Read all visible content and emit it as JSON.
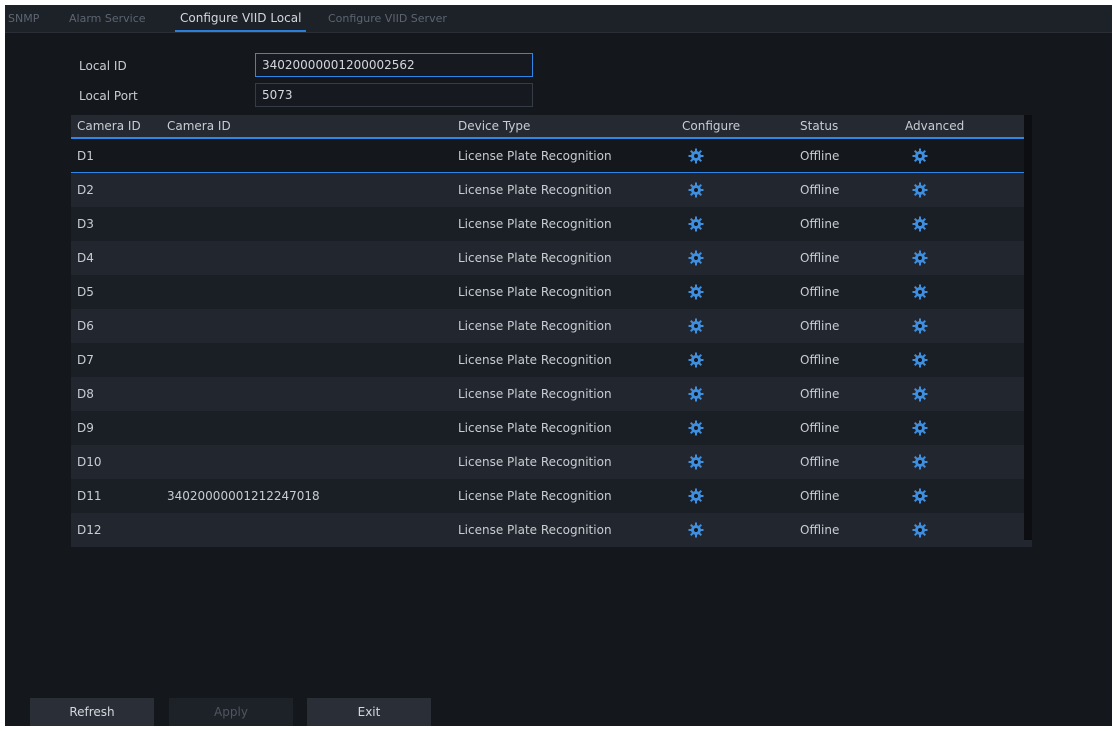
{
  "tabs": [
    {
      "label": "SNMP"
    },
    {
      "label": "Alarm Service"
    },
    {
      "label": "Configure VIID Local"
    },
    {
      "label": "Configure VIID Server"
    }
  ],
  "form": {
    "local_id_label": "Local ID",
    "local_id_value": "34020000001200002562",
    "local_port_label": "Local Port",
    "local_port_value": "5073"
  },
  "table": {
    "headers": {
      "channel": "Camera ID",
      "camera_id": "Camera ID",
      "device_type": "Device Type",
      "configure": "Configure",
      "status": "Status",
      "advanced": "Advanced"
    },
    "rows": [
      {
        "channel": "D1",
        "camera_id": "",
        "device_type": "License Plate Recognition",
        "status": "Offline"
      },
      {
        "channel": "D2",
        "camera_id": "",
        "device_type": "License Plate Recognition",
        "status": "Offline"
      },
      {
        "channel": "D3",
        "camera_id": "",
        "device_type": "License Plate Recognition",
        "status": "Offline"
      },
      {
        "channel": "D4",
        "camera_id": "",
        "device_type": "License Plate Recognition",
        "status": "Offline"
      },
      {
        "channel": "D5",
        "camera_id": "",
        "device_type": "License Plate Recognition",
        "status": "Offline"
      },
      {
        "channel": "D6",
        "camera_id": "",
        "device_type": "License Plate Recognition",
        "status": "Offline"
      },
      {
        "channel": "D7",
        "camera_id": "",
        "device_type": "License Plate Recognition",
        "status": "Offline"
      },
      {
        "channel": "D8",
        "camera_id": "",
        "device_type": "License Plate Recognition",
        "status": "Offline"
      },
      {
        "channel": "D9",
        "camera_id": "",
        "device_type": "License Plate Recognition",
        "status": "Offline"
      },
      {
        "channel": "D10",
        "camera_id": "",
        "device_type": "License Plate Recognition",
        "status": "Offline"
      },
      {
        "channel": "D11",
        "camera_id": "34020000001212247018",
        "device_type": "License Plate Recognition",
        "status": "Offline"
      },
      {
        "channel": "D12",
        "camera_id": "",
        "device_type": "License Plate Recognition",
        "status": "Offline"
      }
    ],
    "configure_icon": "gear-icon",
    "advanced_icon": "gear-icon"
  },
  "buttons": {
    "refresh": "Refresh",
    "apply": "Apply",
    "exit": "Exit"
  },
  "colors": {
    "accent": "#2f86e6",
    "background": "#14171c",
    "icon": "#3f8fe0"
  }
}
